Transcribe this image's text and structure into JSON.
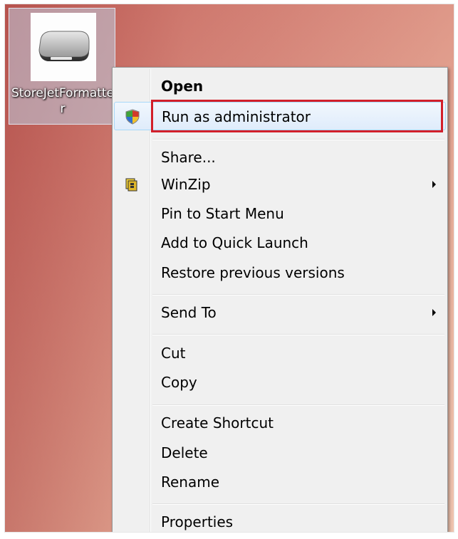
{
  "desktop_icon": {
    "label": "StoreJetFormatter",
    "icon": "usb-drive-icon"
  },
  "context_menu": {
    "items": [
      {
        "label": "Open",
        "bold": true
      },
      {
        "label": "Run as administrator",
        "icon": "uac-shield-icon",
        "highlighted": true
      },
      {
        "label": "Share..."
      },
      {
        "label": "WinZip",
        "icon": "winzip-icon",
        "submenu": true
      },
      {
        "label": "Pin to Start Menu"
      },
      {
        "label": "Add to Quick Launch"
      },
      {
        "label": "Restore previous versions"
      },
      {
        "label": "Send To",
        "submenu": true
      },
      {
        "label": "Cut"
      },
      {
        "label": "Copy"
      },
      {
        "label": "Create Shortcut"
      },
      {
        "label": "Delete"
      },
      {
        "label": "Rename"
      },
      {
        "label": "Properties"
      }
    ]
  },
  "colors": {
    "annotation_box": "#d21f2a",
    "highlight": "#dfecfb"
  }
}
